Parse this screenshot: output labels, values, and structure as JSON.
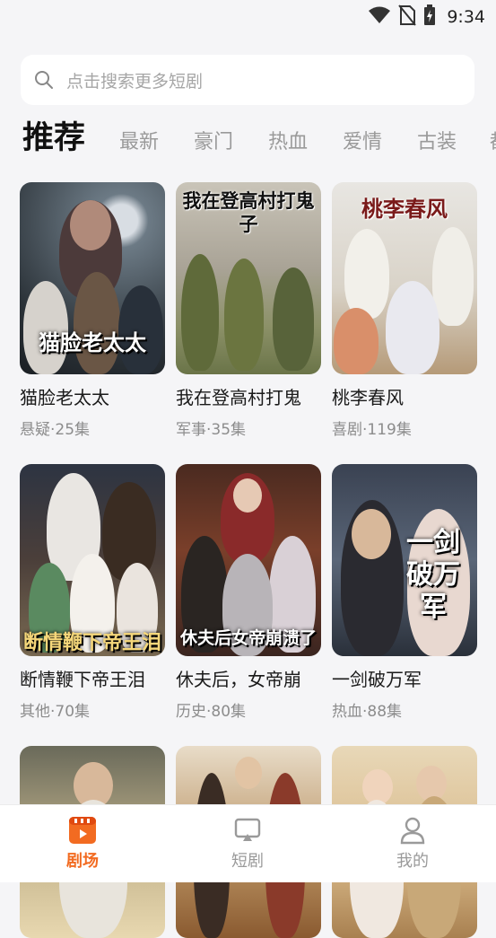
{
  "status_bar": {
    "time": "9:34",
    "icons": [
      "wifi-icon",
      "no-sim-icon",
      "battery-charging-icon"
    ]
  },
  "search": {
    "placeholder": "点击搜索更多短剧"
  },
  "tabs": [
    {
      "label": "推荐",
      "active": true
    },
    {
      "label": "最新"
    },
    {
      "label": "豪门"
    },
    {
      "label": "热血"
    },
    {
      "label": "爱情"
    },
    {
      "label": "古装"
    },
    {
      "label": "都"
    }
  ],
  "dramas": [
    {
      "title": "猫脸老太太",
      "meta": "悬疑·25集",
      "poster_text": "猫脸老太太"
    },
    {
      "title": "我在登高村打鬼",
      "meta": "军事·35集",
      "poster_text": "我在登高村打鬼子"
    },
    {
      "title": "桃李春风",
      "meta": "喜剧·119集",
      "poster_text": "桃李春风"
    },
    {
      "title": "断情鞭下帝王泪",
      "meta": "其他·70集",
      "poster_text": "断情鞭下帝王泪"
    },
    {
      "title": "休夫后，女帝崩",
      "meta": "历史·80集",
      "poster_text": "休夫后女帝崩溃了"
    },
    {
      "title": "一剑破万军",
      "meta": "热血·88集",
      "poster_text": "一剑破万军"
    },
    {
      "title": "",
      "meta": ""
    },
    {
      "title": "",
      "meta": ""
    },
    {
      "title": "",
      "meta": ""
    }
  ],
  "bottom_nav": [
    {
      "label": "剧场",
      "icon": "theater-icon",
      "active": true
    },
    {
      "label": "短剧",
      "icon": "tv-icon"
    },
    {
      "label": "我的",
      "icon": "user-icon"
    }
  ],
  "colors": {
    "accent": "#f26b21",
    "background": "#f5f5f7",
    "muted_text": "#8c8c8c"
  }
}
